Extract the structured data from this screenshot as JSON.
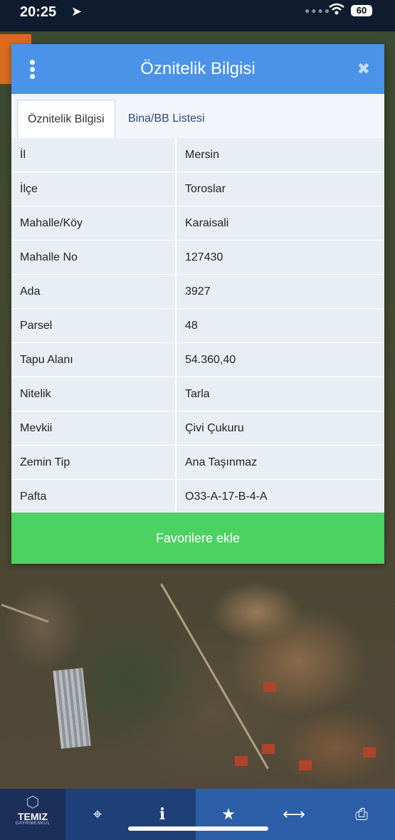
{
  "status_bar": {
    "time": "20:25",
    "battery": "60"
  },
  "dialog": {
    "title": "Öznitelik Bilgisi",
    "tabs": [
      {
        "label": "Öznitelik Bilgisi",
        "active": true
      },
      {
        "label": "Bina/BB Listesi",
        "active": false
      }
    ],
    "rows": [
      {
        "key": "İl",
        "value": "Mersin"
      },
      {
        "key": "İlçe",
        "value": "Toroslar"
      },
      {
        "key": "Mahalle/Köy",
        "value": "Karaisali"
      },
      {
        "key": "Mahalle No",
        "value": "127430"
      },
      {
        "key": "Ada",
        "value": "3927"
      },
      {
        "key": "Parsel",
        "value": "48"
      },
      {
        "key": "Tapu Alanı",
        "value": "54.360,40"
      },
      {
        "key": "Nitelik",
        "value": "Tarla"
      },
      {
        "key": "Mevkii",
        "value": "Çivi Çukuru"
      },
      {
        "key": "Zemin Tip",
        "value": "Ana Taşınmaz"
      },
      {
        "key": "Pafta",
        "value": "O33-A-17-B-4-A"
      }
    ],
    "favorite_button": "Favorilere ekle"
  },
  "toolbar": {
    "logo_brand": "TEMIZ",
    "logo_sub": "GAYRIMENKUL",
    "tools": [
      "crosshair-icon",
      "info-icon",
      "star-icon",
      "measure-icon",
      "print-icon"
    ]
  },
  "colors": {
    "header": "#4a93e8",
    "favorite": "#4cd163",
    "toolbar": "#2d5ea8"
  }
}
